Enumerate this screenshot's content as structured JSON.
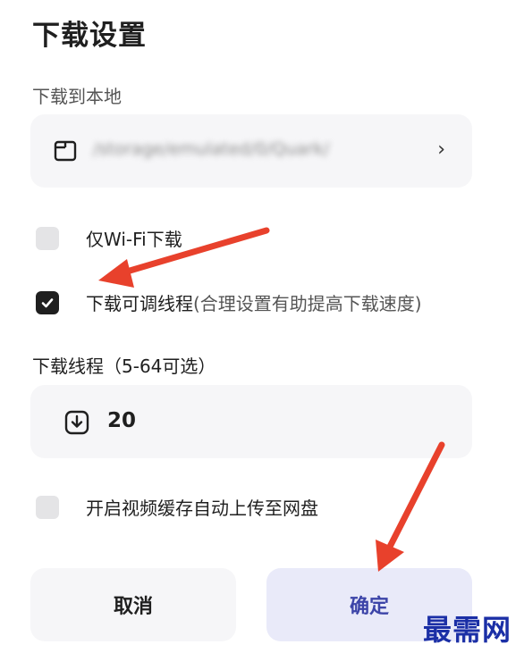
{
  "dialog": {
    "title": "下载设置"
  },
  "download_location": {
    "label": "下载到本地",
    "path": "/storage/emulated/0/Quark/",
    "chevron": "›",
    "icon": "folder-icon"
  },
  "options": {
    "wifi_only": {
      "label": "仅Wi-Fi下载",
      "checked": false
    },
    "adjustable_threads": {
      "label": "下载可调线程",
      "hint": "(合理设置有助提高下载速度)",
      "checked": true
    },
    "auto_upload": {
      "label": "开启视频缓存自动上传至网盘",
      "checked": false
    }
  },
  "threads": {
    "label": "下载线程（5-64可选）",
    "value": "20",
    "icon": "download-icon"
  },
  "buttons": {
    "cancel": "取消",
    "confirm": "确定"
  },
  "colors": {
    "card_bg": "#f6f6f8",
    "confirm_bg": "#e9eaf9",
    "confirm_text": "#3c44a8",
    "arrow": "#e8412c",
    "watermark": "#1b2fa6"
  },
  "watermark": "最需网"
}
